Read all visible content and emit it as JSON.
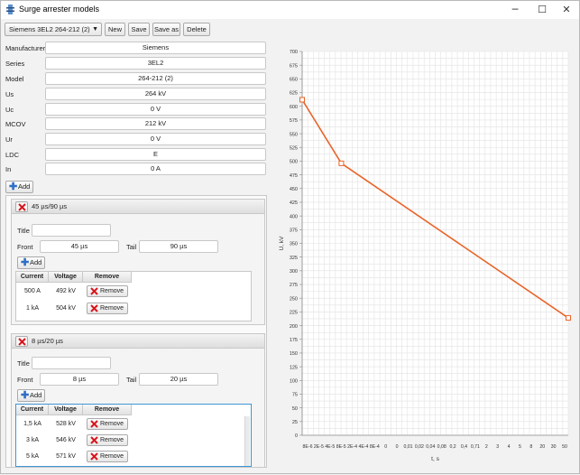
{
  "window": {
    "title": "Surge arrester models",
    "minimize_glyph": "─",
    "maximize_glyph": "☐",
    "close_glyph": "✕"
  },
  "toolbar": {
    "model_selected": "Siemens 3EL2 264-212 (2)",
    "new_label": "New",
    "save_label": "Save",
    "save_as_label": "Save as",
    "delete_label": "Delete"
  },
  "properties": [
    {
      "label": "Manufacturer",
      "value": "Siemens"
    },
    {
      "label": "Series",
      "value": "3EL2"
    },
    {
      "label": "Model",
      "value": "264-212 (2)"
    },
    {
      "label": "Us",
      "value": "264 kV"
    },
    {
      "label": "Uc",
      "value": "0 V"
    },
    {
      "label": "MCOV",
      "value": "212 kV"
    },
    {
      "label": "Ur",
      "value": "0 V"
    },
    {
      "label": "LDC",
      "value": "E"
    },
    {
      "label": "In",
      "value": "0 A"
    }
  ],
  "add_label": "Add",
  "pulses": [
    {
      "name": "45 µs/90 µs",
      "title_label": "Title",
      "title_value": "",
      "front_label": "Front",
      "front_value": "45 µs",
      "tail_label": "Tail",
      "tail_value": "90 µs",
      "add_label": "Add",
      "columns": [
        "Current",
        "Voltage",
        "Remove"
      ],
      "rows": [
        {
          "current": "500 A",
          "voltage": "492 kV",
          "remove": "Remove"
        },
        {
          "current": "1 kA",
          "voltage": "504 kV",
          "remove": "Remove"
        }
      ]
    },
    {
      "name": "8 µs/20 µs",
      "title_label": "Title",
      "title_value": "",
      "front_label": "Front",
      "front_value": "8 µs",
      "tail_label": "Tail",
      "tail_value": "20 µs",
      "add_label": "Add",
      "columns": [
        "Current",
        "Voltage",
        "Remove"
      ],
      "rows": [
        {
          "current": "1,5 kA",
          "voltage": "528 kV",
          "remove": "Remove"
        },
        {
          "current": "3 kA",
          "voltage": "546 kV",
          "remove": "Remove"
        },
        {
          "current": "5 kA",
          "voltage": "571 kV",
          "remove": "Remove"
        }
      ]
    }
  ],
  "colors": {
    "series": "#e8652a",
    "add_icon": "#2f6fc5",
    "remove_icon": "#d9141b",
    "focus": "#3f97d6",
    "grid": "#e2e2e2"
  },
  "icons": {
    "app": "surge-arrester-icon",
    "add": "plus-icon",
    "remove": "red-x-icon",
    "combo": "chevron-down-icon"
  },
  "chart_data": {
    "type": "line",
    "xscale": "log",
    "xlabel": "t, s",
    "ylabel": "U, kV",
    "ylim": [
      0,
      700
    ],
    "yticks": [
      0,
      25,
      50,
      75,
      100,
      125,
      150,
      175,
      200,
      225,
      250,
      275,
      300,
      325,
      350,
      375,
      400,
      425,
      450,
      475,
      500,
      525,
      550,
      575,
      600,
      625,
      650,
      675,
      700
    ],
    "xtick_labels": [
      "8E-6",
      "2E-5",
      "4E-5",
      "8E-5",
      "2E-4",
      "4E-4",
      "8E-4",
      "0",
      "0",
      "0,01",
      "0,02",
      "0,04",
      "0,08",
      "0,2",
      "0,4",
      "0,71",
      "2",
      "3",
      "4",
      "5",
      "8",
      "20",
      "30",
      "50"
    ],
    "grid": true,
    "series": [
      {
        "x": [
          8e-06,
          8e-05,
          50
        ],
        "y": [
          612,
          496,
          214
        ],
        "markers": true
      }
    ]
  }
}
